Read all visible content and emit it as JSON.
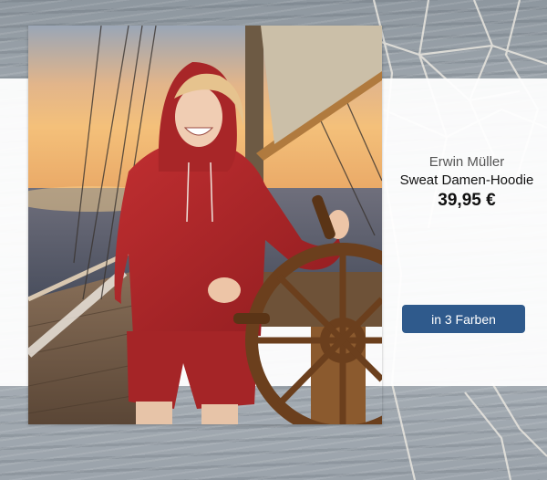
{
  "product": {
    "brand": "Erwin Müller",
    "name": "Sweat Damen-Hoodie",
    "price": "39,95 €"
  },
  "cta": {
    "label": "in 3 Farben"
  },
  "colors": {
    "cta_bg": "#2f5a8c",
    "hoodie": "#b3262a"
  }
}
